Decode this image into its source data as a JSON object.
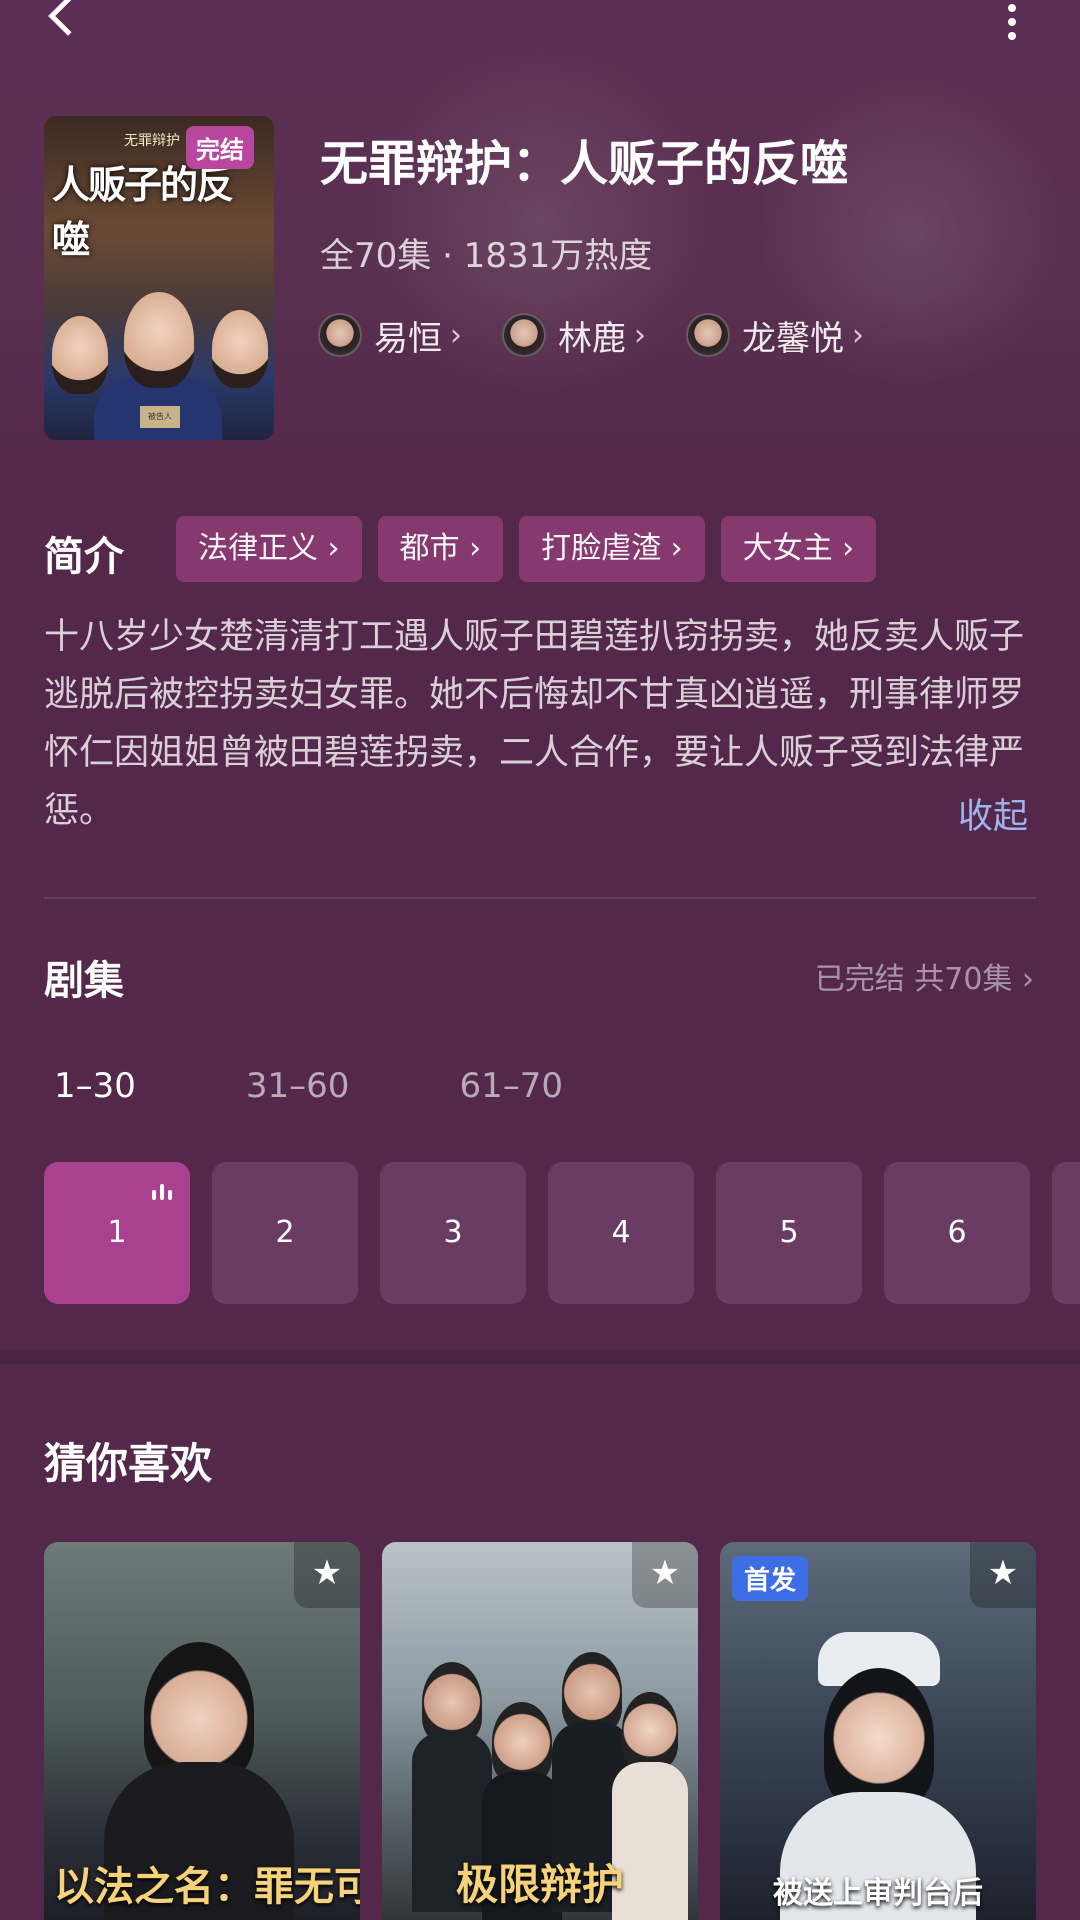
{
  "show": {
    "title": "无罪辩护：人贩子的反噬",
    "meta": "全70集 · 1831万热度",
    "status_badge": "完结",
    "poster_title": "人贩子的反噬",
    "poster_subtitle": "无罪辩护"
  },
  "cast": [
    {
      "name": "易恒"
    },
    {
      "name": "林鹿"
    },
    {
      "name": "龙馨悦"
    }
  ],
  "intro": {
    "label": "简介",
    "tags": [
      "法律正义",
      "都市",
      "打脸虐渣",
      "大女主"
    ],
    "synopsis": "十八岁少女楚清清打工遇人贩子田碧莲扒窃拐卖，她反卖人贩子逃脱后被控拐卖妇女罪。她不后悔却不甘真凶逍遥，刑事律师罗怀仁因姐姐曾被田碧莲拐卖，二人合作，要让人贩子受到法律严惩。",
    "collapse_label": "收起"
  },
  "episodes": {
    "label": "剧集",
    "status": "已完结 共70集",
    "ranges": [
      "1–30",
      "31–60",
      "61–70"
    ],
    "active_range": 0,
    "items": [
      "1",
      "2",
      "3",
      "4",
      "5",
      "6"
    ],
    "active_episode": 0
  },
  "recommend": {
    "label": "猜你喜欢",
    "cards": [
      {
        "title": "以法之名：罪无可赦",
        "badge": ""
      },
      {
        "title": "极限辩护",
        "badge": ""
      },
      {
        "title": "被送上审判台后",
        "badge": "首发"
      }
    ]
  },
  "icons": {
    "back": "back-arrow-icon",
    "more": "more-vertical-icon",
    "chevron": "chevron-right-icon",
    "star": "star-icon",
    "playing": "playing-bars-icon"
  },
  "colors": {
    "background": "#53284b",
    "tag_bg": "#86396f",
    "episode_bg": "#6a3c63",
    "episode_active_bg": "#a8428e",
    "badge_done": "#b8479f",
    "collapse_link": "#9db4ef",
    "first_badge": "#3d6ee8"
  }
}
